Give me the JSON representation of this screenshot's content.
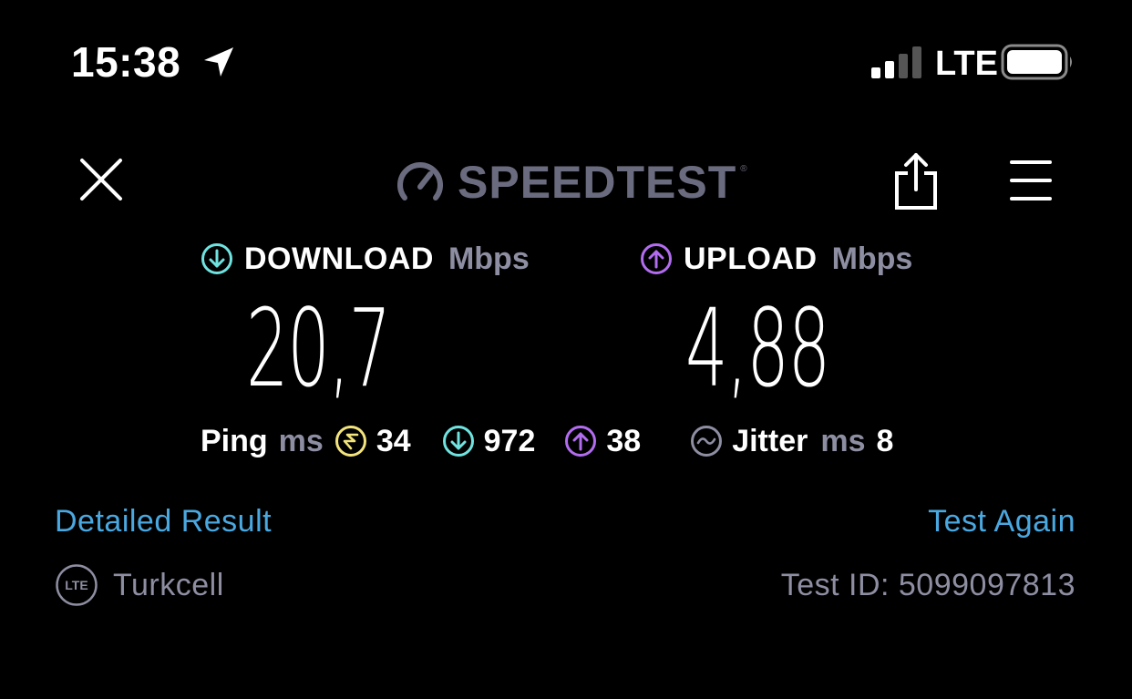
{
  "status_bar": {
    "time": "15:38",
    "network": "LTE",
    "location_icon": "location-arrow-icon",
    "signal_icon": "cellular-signal-icon",
    "battery_icon": "battery-icon"
  },
  "header": {
    "logo_text": "SPEEDTEST",
    "logo_tm": "®",
    "close_icon": "close-icon",
    "share_icon": "share-icon",
    "menu_icon": "hamburger-menu-icon"
  },
  "download": {
    "label": "DOWNLOAD",
    "unit": "Mbps",
    "value": "20,7",
    "color": "#6fe3e0"
  },
  "upload": {
    "label": "UPLOAD",
    "unit": "Mbps",
    "value": "4,88",
    "color": "#b26cf0"
  },
  "ping": {
    "label": "Ping",
    "unit": "ms",
    "idle": "34",
    "download": "972",
    "upload": "38",
    "idle_color": "#f3e37c"
  },
  "jitter": {
    "label": "Jitter",
    "unit": "ms",
    "value": "8"
  },
  "links": {
    "detailed": "Detailed Result",
    "again": "Test Again"
  },
  "footer": {
    "carrier_badge": "LTE",
    "carrier": "Turkcell",
    "test_id": "Test ID: 5099097813"
  },
  "colors": {
    "background": "#000000",
    "muted": "#8e8ea3",
    "link": "#4aa8e0",
    "logo": "#6b6b7f"
  }
}
